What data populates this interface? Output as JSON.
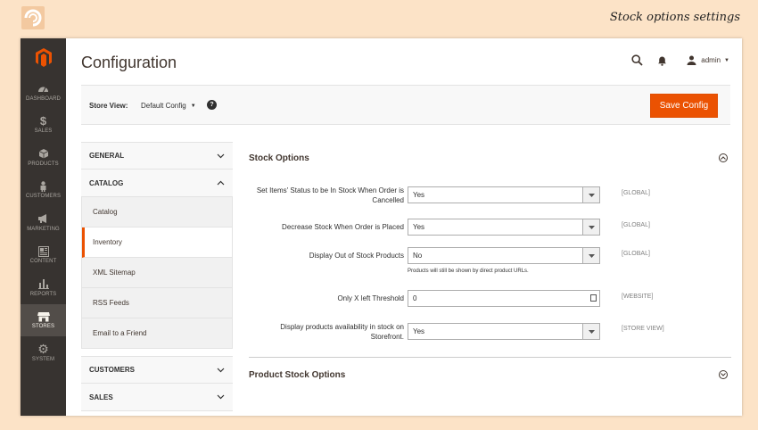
{
  "banner": {
    "title": "Stock options settings",
    "logo_icon": "brand-logo-icon"
  },
  "sidebar": {
    "logo_icon": "magento-logo-icon",
    "items": [
      {
        "label": "DASHBOARD",
        "icon": "dashboard-icon"
      },
      {
        "label": "SALES",
        "icon": "dollar-icon"
      },
      {
        "label": "PRODUCTS",
        "icon": "box-icon"
      },
      {
        "label": "CUSTOMERS",
        "icon": "person-icon"
      },
      {
        "label": "MARKETING",
        "icon": "megaphone-icon"
      },
      {
        "label": "CONTENT",
        "icon": "content-icon"
      },
      {
        "label": "REPORTS",
        "icon": "bar-chart-icon"
      },
      {
        "label": "STORES",
        "icon": "store-icon",
        "active": true
      },
      {
        "label": "SYSTEM",
        "icon": "gear-icon"
      }
    ]
  },
  "header": {
    "title": "Configuration",
    "user": "admin"
  },
  "toolbar": {
    "store_view_label": "Store View:",
    "store_view_value": "Default Config",
    "save_label": "Save Config"
  },
  "tabs": {
    "general": "GENERAL",
    "catalog": "CATALOG",
    "catalog_items": [
      "Catalog",
      "Inventory",
      "XML Sitemap",
      "RSS Feeds",
      "Email to a Friend"
    ],
    "customers": "CUSTOMERS",
    "sales": "SALES"
  },
  "stock_options": {
    "title": "Stock Options",
    "fields": [
      {
        "label": "Set Items' Status to be In Stock When Order is Cancelled",
        "value": "Yes",
        "scope": "[GLOBAL]"
      },
      {
        "label": "Decrease Stock When Order is Placed",
        "value": "Yes",
        "scope": "[GLOBAL]"
      },
      {
        "label": "Display Out of Stock Products",
        "value": "No",
        "scope": "[GLOBAL]",
        "note": "Products will still be shown by direct product URLs."
      },
      {
        "label": "Only X left Threshold",
        "value": "0",
        "scope": "[WEBSITE]"
      },
      {
        "label": "Display products availability in stock on Storefront.",
        "value": "Yes",
        "scope": "[STORE VIEW]"
      }
    ]
  },
  "product_stock_options": {
    "title": "Product Stock Options"
  },
  "colors": {
    "accent": "#eb5202",
    "sidebar": "#373330",
    "background": "#fce3c7"
  }
}
